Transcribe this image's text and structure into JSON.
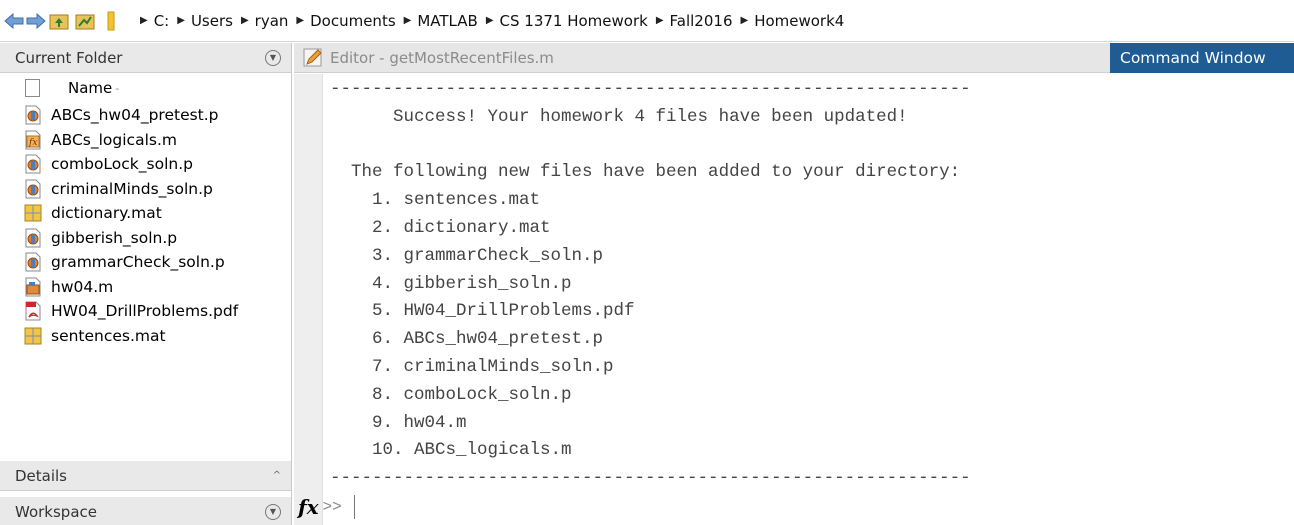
{
  "toolbar": {
    "back_icon": "back-arrow-icon",
    "forward_icon": "forward-arrow-icon",
    "up_icon": "up-folder-icon",
    "browse_icon": "browse-folder-icon",
    "folder_icon": "folder-icon"
  },
  "breadcrumb": [
    "C:",
    "Users",
    "ryan",
    "Documents",
    "MATLAB",
    "CS 1371 Homework",
    "Fall2016",
    "Homework4"
  ],
  "current_folder": {
    "title": "Current Folder",
    "column_name": "Name",
    "sort_indicator": "-",
    "files": [
      {
        "name": "ABCs_hw04_pretest.p",
        "type": "p"
      },
      {
        "name": "ABCs_logicals.m",
        "type": "fm"
      },
      {
        "name": "comboLock_soln.p",
        "type": "p"
      },
      {
        "name": "criminalMinds_soln.p",
        "type": "p"
      },
      {
        "name": "dictionary.mat",
        "type": "mat"
      },
      {
        "name": "gibberish_soln.p",
        "type": "p"
      },
      {
        "name": "grammarCheck_soln.p",
        "type": "p"
      },
      {
        "name": "hw04.m",
        "type": "m"
      },
      {
        "name": "HW04_DrillProblems.pdf",
        "type": "pdf"
      },
      {
        "name": "sentences.mat",
        "type": "mat"
      }
    ]
  },
  "details": {
    "title": "Details",
    "caret": "^"
  },
  "workspace": {
    "title": "Workspace"
  },
  "editor_tab": {
    "label": "Editor - getMostRecentFiles.m"
  },
  "command_window_tab": {
    "label": "Command Window"
  },
  "output_lines": [
    "-------------------------------------------------------------",
    "      Success! Your homework 4 files have been updated!",
    "",
    "  The following new files have been added to your directory:",
    "    1. sentences.mat",
    "    2. dictionary.mat",
    "    3. grammarCheck_soln.p",
    "    4. gibberish_soln.p",
    "    5. HW04_DrillProblems.pdf",
    "    6. ABCs_hw04_pretest.p",
    "    7. criminalMinds_soln.p",
    "    8. comboLock_soln.p",
    "    9. hw04.m",
    "    10. ABCs_logicals.m",
    "-------------------------------------------------------------"
  ],
  "prompt": {
    "fx": "fx",
    "symbol": ">>"
  },
  "colors": {
    "command_tab_bg": "#1f5c94",
    "panel_header_bg": "#e9e9e9"
  }
}
